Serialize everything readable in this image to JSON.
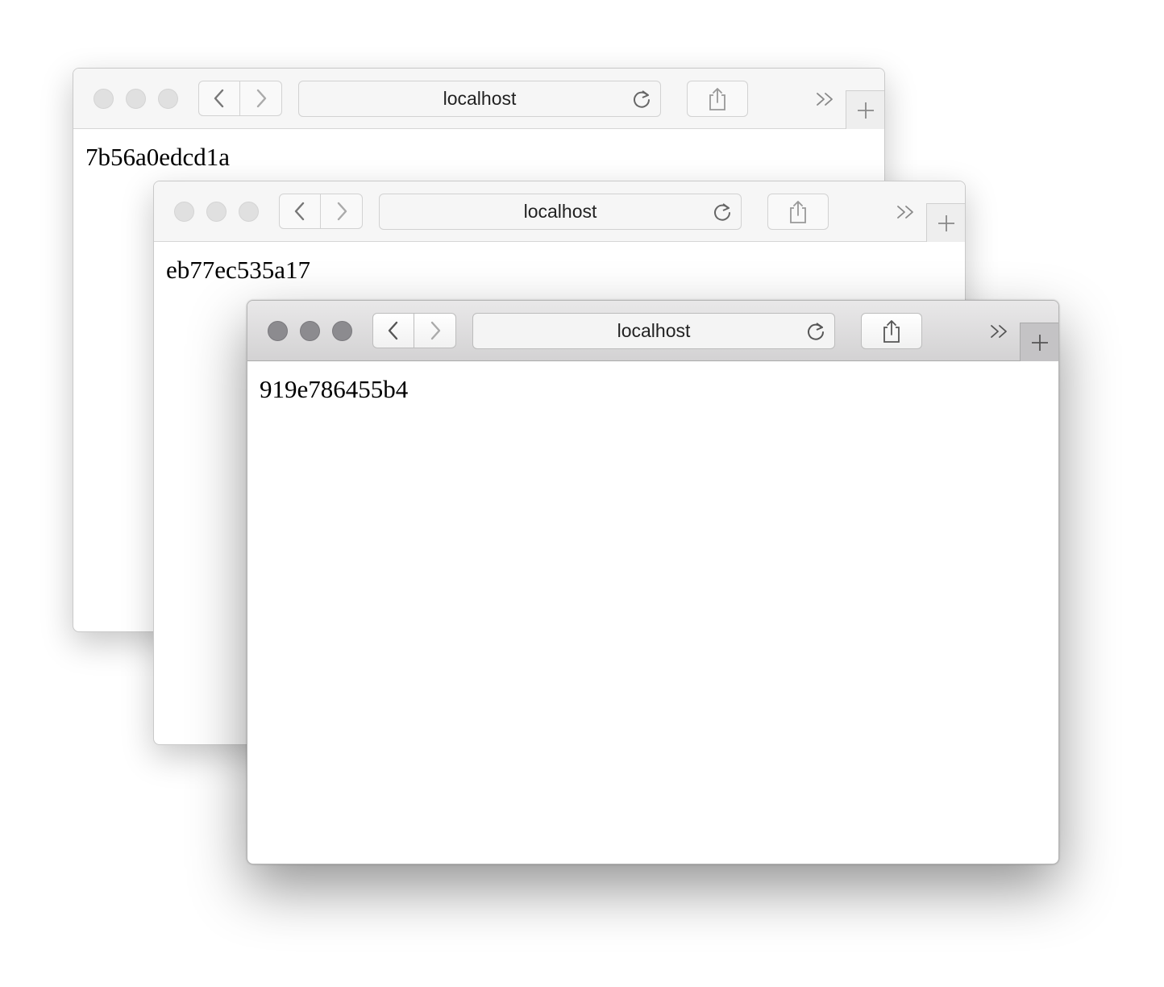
{
  "windows": [
    {
      "address": "localhost",
      "content": "7b56a0edcd1a"
    },
    {
      "address": "localhost",
      "content": "eb77ec535a17"
    },
    {
      "address": "localhost",
      "content": "919e786455b4"
    }
  ],
  "icons": {
    "back": "chevron-left-icon",
    "forward": "chevron-right-icon",
    "reload": "reload-icon",
    "share": "share-icon",
    "overflow": "double-chevron-right-icon",
    "new_tab": "plus-icon"
  },
  "colors": {
    "inactive_light": "#e0e0e0",
    "active_light": "#8c8b8f"
  }
}
